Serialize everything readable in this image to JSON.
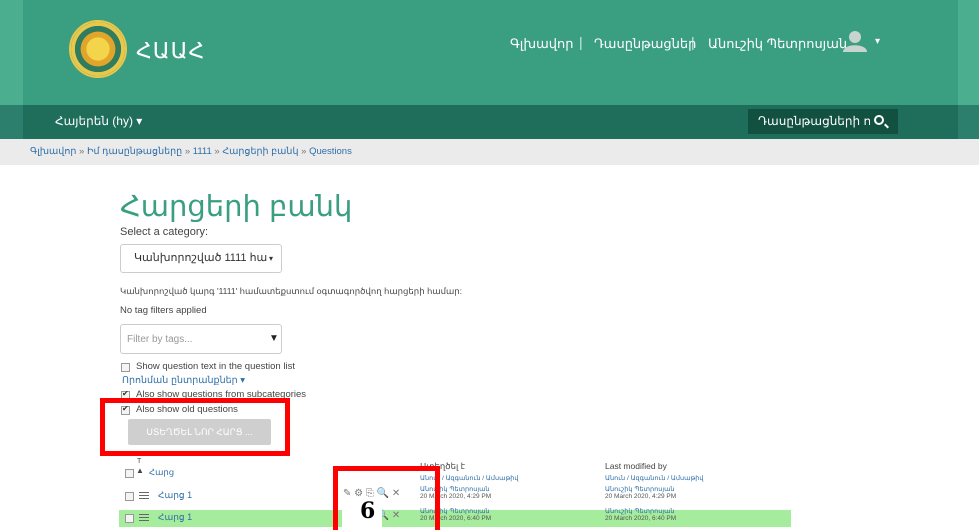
{
  "header": {
    "brand": "ՀԱԱՀ",
    "nav": [
      "Գլխավոր",
      "Դասընթացներ",
      "Անուշիկ Պետրոսյան"
    ],
    "separator": "|"
  },
  "navbar": {
    "language": "Հայերեն (hy) ▾",
    "search_text": "Դասընթացների որո"
  },
  "breadcrumb": {
    "items": [
      "Գլխավոր",
      "Իմ դասընթացները",
      "1111",
      "Հարցերի բանկ",
      "Questions"
    ],
    "separator": "»"
  },
  "page": {
    "title": "Հարցերի բանկ",
    "select_category_label": "Select a category:",
    "category_value": "Կանխորոշված 1111 հա",
    "category_description": "Կանխորոշված կարգ '1111' համատեքստում օգտագործվող հարցերի համար:",
    "no_tag_filters": "No tag filters applied",
    "filter_placeholder": "Filter by tags...",
    "show_question_text": "Show question text in the question list",
    "search_options": "Որոնման ընտրանքներ ▾",
    "show_from_subcategories": "Also show questions from subcategories",
    "show_old": "Also show old questions",
    "add_button": "ՍՏԵՂԾԵԼ ՆՈՐ ՀԱՐՑ ..."
  },
  "table": {
    "col_question": "Հարց",
    "sort_marker": "T",
    "col_created": "Ստեղծել է",
    "col_created_sub": "Անուն / Ազգանուն / Ամսաթիվ",
    "col_modified": "Last modified by",
    "col_modified_sub": "Անուն / Ազգանուն / Ամսաթիվ",
    "rows": [
      {
        "name": "Հարց 1",
        "created_by": "Անուշիկ Պետրոսյան",
        "created_at": "20 March 2020, 4:29 PM",
        "modified_by": "Անուշիկ Պետրոսյան",
        "modified_at": "20 March 2020, 4:29 PM"
      },
      {
        "name": "Հարց 1",
        "created_by": "Անուշիկ Պետրոսյան",
        "created_at": "20 March 2020, 6:40 PM",
        "modified_by": "Անուշիկ Պետրոսյան",
        "modified_at": "20 March 2020, 6:40 PM"
      }
    ]
  },
  "annotation": {
    "number": "6",
    "color": "#ff0000"
  },
  "colors": {
    "header": "#3a9e80",
    "navbar": "#1f6e5c",
    "highlight_row": "#a5ec9c",
    "title": "#3a9e80",
    "link": "#2f6fa7"
  }
}
